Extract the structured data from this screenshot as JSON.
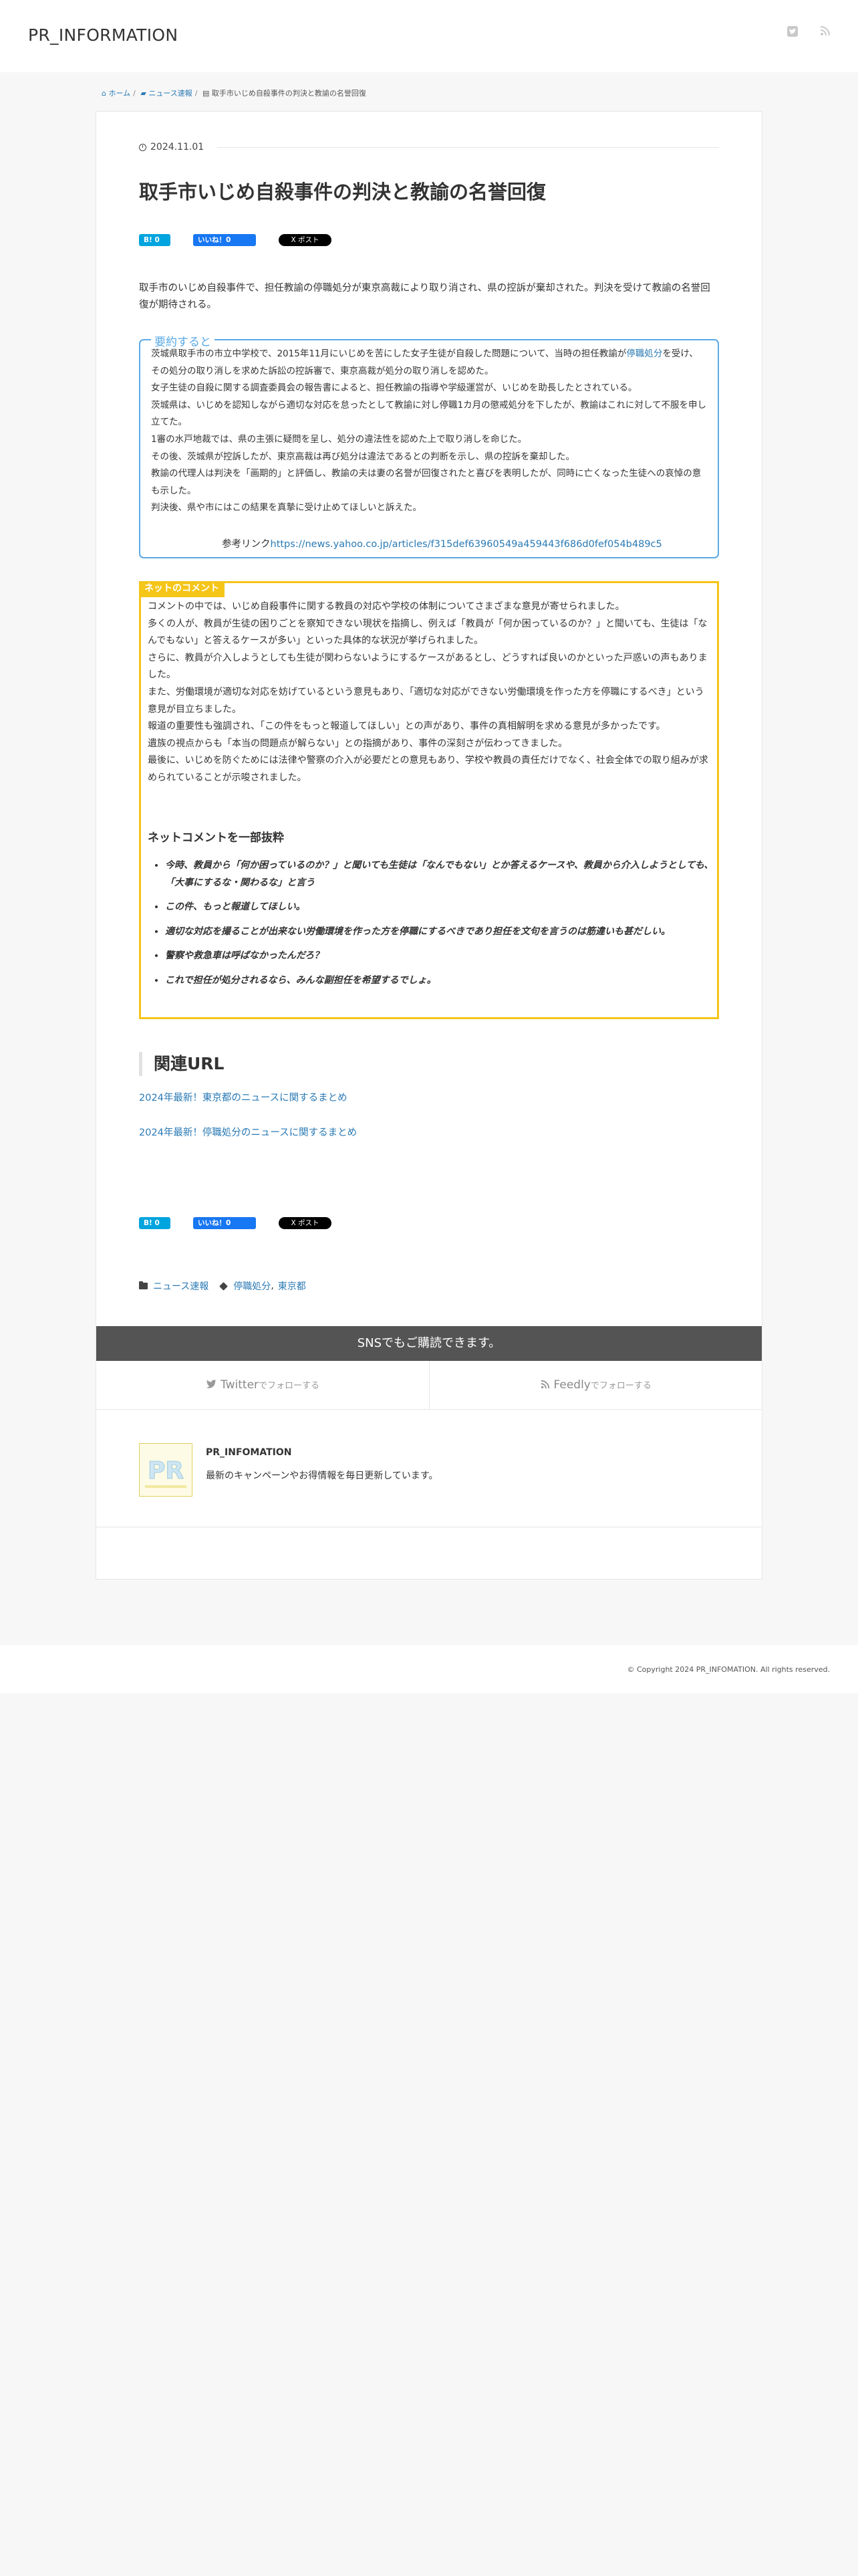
{
  "site": {
    "title": "PR_INFORMATION"
  },
  "breadcrumb": {
    "home": "ホーム",
    "category": "ニュース速報",
    "current": "取手市いじめ自殺事件の判決と教諭の名誉回復"
  },
  "post": {
    "date": "2024.11.01",
    "title": "取手市いじめ自殺事件の判決と教諭の名誉回復",
    "lead": "取手市のいじめ自殺事件で、担任教諭の停職処分が東京高裁により取り消され、県の控訴が棄却された。判決を受けて教諭の名誉回復が期待される。"
  },
  "share": {
    "hatena": "B! 0",
    "facebook": "いいね！0",
    "x": "X ポスト"
  },
  "summary": {
    "label": "要約すると",
    "lines": [
      "茨城県取手市の市立中学校で、2015年11月にいじめを苦にした女子生徒が自殺した問題について、当時の担任教諭が",
      "停職処分",
      "を受け、その処分の取り消しを求めた訴訟の控訴審で、東京高裁が処分の取り消しを認めた。",
      "女子生徒の自殺に関する調査委員会の報告書によると、担任教諭の指導や学級運営が、いじめを助長したとされている。",
      "茨城県は、いじめを認知しながら適切な対応を怠ったとして教諭に対し停職1カ月の懲戒処分を下したが、教諭はこれに対して不服を申し立てた。",
      "1審の水戸地裁では、県の主張に疑問を呈し、処分の違法性を認めた上で取り消しを命じた。",
      "その後、茨城県が控訴したが、東京高裁は再び処分は違法であるとの判断を示し、県の控訴を棄却した。",
      "教諭の代理人は判決を「画期的」と評価し、教諭の夫は妻の名誉が回復されたと喜びを表明したが、同時に亡くなった生徒への哀悼の意も示した。",
      "判決後、県や市にはこの結果を真摯に受け止めてほしいと訴えた。"
    ],
    "ref_label": "参考リンク",
    "ref_url": "https://news.yahoo.co.jp/articles/f315def63960549a459443f686d0fef054b489c5"
  },
  "comments": {
    "label": "ネットのコメント",
    "paragraphs": [
      "コメントの中では、いじめ自殺事件に関する教員の対応や学校の体制についてさまざまな意見が寄せられました。",
      "多くの人が、教員が生徒の困りごとを察知できない現状を指摘し、例えば「教員が「何か困っているのか？」と聞いても、生徒は「なんでもない」と答えるケースが多い」といった具体的な状況が挙げられました。",
      "さらに、教員が介入しようとしても生徒が関わらないようにするケースがあるとし、どうすれば良いのかといった戸惑いの声もありました。",
      "また、労働環境が適切な対応を妨げているという意見もあり、「適切な対応ができない労働環境を作った方を停職にするべき」という意見が目立ちました。",
      "報道の重要性も強調され、「この件をもっと報道してほしい」との声があり、事件の真相解明を求める意見が多かったです。",
      "遺族の視点からも「本当の問題点が解らない」との指摘があり、事件の深刻さが伝わってきました。",
      "最後に、いじめを防ぐためには法律や警察の介入が必要だとの意見もあり、学校や教員の責任だけでなく、社会全体での取り組みが求められていることが示唆されました。"
    ],
    "excerpt_heading": "ネットコメントを一部抜粋",
    "excerpts": [
      "今時、教員から「何か困っているのか？」と聞いても生徒は「なんでもない」とか答えるケースや、教員から介入しようとしても、「大事にするな・関わるな」と言う",
      "この件、もっと報道してほしい。",
      "適切な対応を撮ることが出来ない労働環境を作った方を停職にするべきであり担任を文句を言うのは筋違いも甚だしい。",
      "警察や救急車は呼ばなかったんだろ？",
      "これで担任が処分されるなら、みんな副担任を希望するでしょ。"
    ]
  },
  "related": {
    "heading": "関連URL",
    "links": [
      "2024年最新！東京都のニュースに関するまとめ",
      "2024年最新！停職処分のニュースに関するまとめ"
    ]
  },
  "tags": {
    "category": "ニュース速報",
    "tag1": "停職処分",
    "tag2": "東京都",
    "sep": ","
  },
  "sns": {
    "heading": "SNSでもご購読できます。",
    "twitter": "Twitter",
    "feedly": "Feedly",
    "follow": "でフォローする"
  },
  "author": {
    "name": "PR_INFOMATION",
    "desc": "最新のキャンペーンやお得情報を毎日更新しています。",
    "avatar_text": "PR"
  },
  "footer": {
    "copyright": "© Copyright 2024 PR_INFOMATION. All rights reserved."
  },
  "colors": {
    "accent": "#2a7ab5",
    "summary_border": "#5aa9e6",
    "comment_border": "#f5c518",
    "sns_bar": "#545454"
  }
}
